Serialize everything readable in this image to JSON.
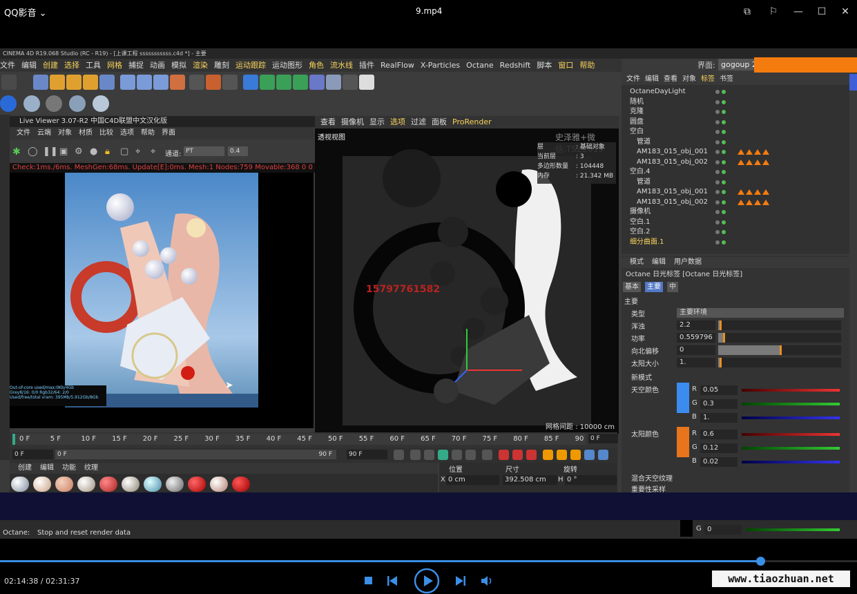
{
  "player": {
    "app_name": "QQ影音",
    "file_name": "9.mp4",
    "current_time": "02:14:38",
    "total_time": "02:31:37",
    "time_display": "02:14:38 / 02:31:37",
    "progress": 0.887,
    "watermark_site": "www.tiaozhuan.net",
    "colors": {
      "accent": "#3a8fe6",
      "background": "#000000"
    }
  },
  "c4d": {
    "title": "CINEMA 4D R19.068 Studio (RC - R19) - [上课工程 sssssssssss.c4d *] - 主要",
    "menu": [
      "文件",
      "编辑",
      "创建",
      "选择",
      "工具",
      "网格",
      "捕捉",
      "动画",
      "模拟",
      "渲染",
      "雕刻",
      "运动跟踪",
      "运动图形",
      "角色",
      "流水线",
      "插件",
      "RealFlow",
      "X-Particles",
      "Octane",
      "Redshift",
      "脚本",
      "窗口",
      "帮助"
    ],
    "menu_highlight": [
      "创建",
      "选择",
      "网格",
      "渲染",
      "运动跟踪",
      "角色",
      "流水线",
      "窗口",
      "帮助"
    ],
    "layout_label": "界面:",
    "layout_value": "gogoup 2",
    "status_prefix": "Octane:",
    "status_text": "Stop and reset render data"
  },
  "live_viewer": {
    "title": "Live Viewer 3.07-R2 中国C4D联盟中文汉化版",
    "menu": [
      "文件",
      "云端",
      "对象",
      "材质",
      "比较",
      "选项",
      "帮助",
      "界面"
    ],
    "channel_label": "通道:",
    "channel_value": "PT",
    "value": "0.4",
    "status": "Check:1ms./6ms. MeshGen:68ms. Update[E]:0ms. Mesh:1 Nodes:759 Movable:368  0 0",
    "info_lines": [
      "Out-of-core used/max:0Kb/4Gb",
      "Grey8/16: 0/0     Rgb32/64: 2/0",
      "Used/free/total vram: 395Mb/5.912Gb/8Gb"
    ]
  },
  "viewport": {
    "menu": [
      "查看",
      "摄像机",
      "显示",
      "选项",
      "过滤",
      "面板",
      "ProRender"
    ],
    "menu_highlight": [
      "选项",
      "ProRender"
    ],
    "label": "透视视图",
    "watermark": "史泽雅+微信:TSZ2019",
    "phone": "15797761582",
    "grid_spacing": "网格间距 : 10000 cm",
    "stats": [
      {
        "k": "层",
        "v": ": 基础对象"
      },
      {
        "k": "当前层",
        "v": ": 3"
      },
      {
        "k": "多边形数量",
        "v": ": 104448"
      },
      {
        "k": "内存",
        "v": ": 21.342 MB"
      }
    ]
  },
  "object_manager": {
    "menu": [
      "文件",
      "编辑",
      "查看",
      "对象",
      "标签",
      "书签"
    ],
    "menu_highlight": [
      "标签"
    ],
    "rows": [
      {
        "name": "OctaneDayLight",
        "indent": 0,
        "tris": 0
      },
      {
        "name": "随机",
        "indent": 0,
        "tris": 0
      },
      {
        "name": "克隆",
        "indent": 0,
        "tris": 0
      },
      {
        "name": "圆盘",
        "indent": 0,
        "tris": 0
      },
      {
        "name": "空白",
        "indent": 0,
        "tris": 0
      },
      {
        "name": "管道",
        "indent": 1,
        "tris": 0
      },
      {
        "name": "AM183_015_obj_001",
        "indent": 1,
        "tris": 4
      },
      {
        "name": "AM183_015_obj_002",
        "indent": 1,
        "tris": 4
      },
      {
        "name": "空白.4",
        "indent": 0,
        "tris": 0
      },
      {
        "name": "管道",
        "indent": 1,
        "tris": 0
      },
      {
        "name": "AM183_015_obj_001",
        "indent": 1,
        "tris": 4
      },
      {
        "name": "AM183_015_obj_002",
        "indent": 1,
        "tris": 4
      },
      {
        "name": "摄像机",
        "indent": 0,
        "tris": 0
      },
      {
        "name": "空白.1",
        "indent": 0,
        "tris": 0
      },
      {
        "name": "空白.2",
        "indent": 0,
        "tris": 0
      },
      {
        "name": "细分曲面.1",
        "indent": 0,
        "tris": 0
      }
    ]
  },
  "attribute_manager": {
    "menu": [
      "模式",
      "编辑",
      "用户数据"
    ],
    "title": "Octane 日光标签 [Octane 日光标签]",
    "tabs": [
      "基本",
      "主要",
      "中"
    ],
    "active_tab": "主要",
    "section": "主要",
    "type_label": "类型",
    "type_value": "主要环境",
    "props": [
      {
        "label": "浑浊",
        "value": "2.2",
        "fraction": 0.01
      },
      {
        "label": "功率",
        "value": "0.559796",
        "fraction": 0.04
      },
      {
        "label": "向北偏移",
        "value": "0",
        "fraction": 0.5
      },
      {
        "label": "太阳大小",
        "value": "1.",
        "fraction": 0.01
      }
    ],
    "new_model_label": "新模式",
    "sky_color_label": "天空颜色",
    "sky_color": {
      "hex": "#3c8cf0",
      "r": "0.05",
      "g": "0.3",
      "b": "1."
    },
    "sun_color_label": "太阳颜色",
    "sun_color": {
      "hex": "#e8741c",
      "r": "0.6",
      "g": "0.12",
      "b": "0.02"
    },
    "mix_sky_label": "混合天空纹理",
    "importance_label": "重要性采样",
    "extra_g": "0"
  },
  "timeline": {
    "ticks": [
      "0 F",
      "5 F",
      "10 F",
      "15 F",
      "20 F",
      "25 F",
      "30 F",
      "35 F",
      "40 F",
      "45 F",
      "50 F",
      "55 F",
      "60 F",
      "65 F",
      "70 F",
      "75 F",
      "80 F",
      "85 F",
      "90"
    ],
    "current_frame": "0 F",
    "start": "0 F",
    "range_start": "0 F",
    "range_end": "90 F",
    "end": "90 F"
  },
  "materials": {
    "menu": [
      "创建",
      "编辑",
      "功能",
      "纹理"
    ]
  },
  "coords": {
    "headers": [
      "位置",
      "尺寸",
      "旋转"
    ],
    "x_label": "X",
    "x_pos": "0 cm",
    "x_size": "392.508 cm",
    "h_label": "H",
    "h_rot": "0 °"
  }
}
